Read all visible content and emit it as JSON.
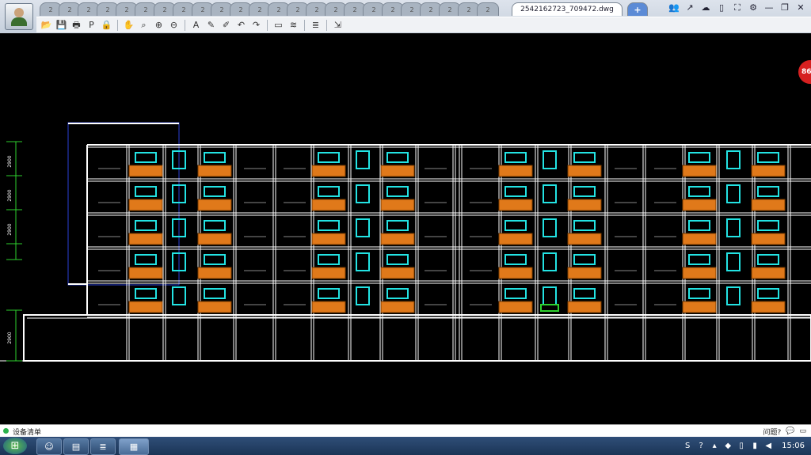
{
  "tabs": {
    "inactive_label": "2",
    "inactive_count": 24,
    "active_label": "2542162723_709472.dwg",
    "add_label": "+"
  },
  "window_controls": {
    "user": "👥",
    "share": "↗",
    "cloud": "☁",
    "phone": "▯",
    "fullscreen": "⛶",
    "settings": "⚙",
    "minimize": "—",
    "restore": "❐",
    "close": "✕"
  },
  "toolbar": [
    "open-icon",
    "save-icon",
    "print-icon",
    "pdf-icon",
    "lock-icon",
    "sep",
    "pan-icon",
    "zoom-window-icon",
    "zoom-in-icon",
    "zoom-out-icon",
    "sep",
    "text-icon",
    "pencil-icon",
    "marker-icon",
    "undo-icon",
    "redo-icon",
    "sep",
    "measure-icon",
    "dimension-icon",
    "sep",
    "layers-icon",
    "sep",
    "export-icon"
  ],
  "toolbar_glyphs": {
    "open-icon": "📂",
    "save-icon": "💾",
    "print-icon": "🖶",
    "pdf-icon": "P",
    "lock-icon": "🔒",
    "pan-icon": "✋",
    "zoom-window-icon": "⌕",
    "zoom-in-icon": "⊕",
    "zoom-out-icon": "⊖",
    "text-icon": "A",
    "pencil-icon": "✎",
    "marker-icon": "✐",
    "undo-icon": "↶",
    "redo-icon": "↷",
    "measure-icon": "▭",
    "dimension-icon": "≋",
    "layers-icon": "≣",
    "export-icon": "⇲"
  },
  "drawing": {
    "dimension_labels": [
      "2900",
      "2900",
      "2900",
      "2900"
    ],
    "colors": {
      "line": "#ffffff",
      "window": "#23e3e3",
      "balcony": "#e0791a",
      "dim": "#2ed12e",
      "blue": "#2a3fd6"
    }
  },
  "badge": {
    "text": "86"
  },
  "statusbar": {
    "label": "设备清单",
    "right_text": "问题?"
  },
  "taskbar": {
    "start": "⊞",
    "clock": "15:06"
  }
}
